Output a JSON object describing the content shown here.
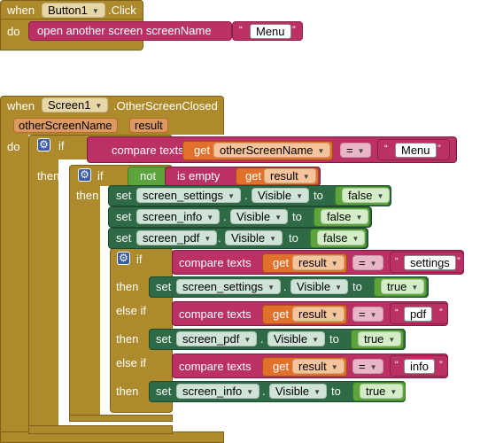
{
  "block1": {
    "when": "when",
    "component": "Button1",
    "event": ".Click",
    "do": "do",
    "open": "open another screen  screenName",
    "string_value": "Menu"
  },
  "block2": {
    "when": "when",
    "component": "Screen1",
    "event": ".OtherScreenClosed",
    "param1": "otherScreenName",
    "param2": "result",
    "do": "do",
    "if": "if",
    "then": "then",
    "compare": "compare texts",
    "get": "get",
    "var_other": "otherScreenName",
    "var_result": "result",
    "op_eq": "=",
    "str_menu": "Menu",
    "not": "not",
    "is_empty": "is empty",
    "set": "set",
    "to": "to",
    "else_if": "else if",
    "visible": "Visible",
    "dot": ".",
    "false": "false",
    "true": "true",
    "screen_settings": "screen_settings",
    "screen_info": "screen_info",
    "screen_pdf": "screen_pdf",
    "str_settings": "settings",
    "str_pdf": "pdf",
    "str_info": "info"
  },
  "icons": {
    "gear": "gear-icon",
    "dropdown": "dropdown-arrow-icon"
  },
  "colors": {
    "event": "#ad8a2c",
    "text": "#bb3165",
    "logic": "#5ba53c",
    "component": "#2d6a45",
    "variable": "#e0702a",
    "control": "#ad8a2c"
  }
}
